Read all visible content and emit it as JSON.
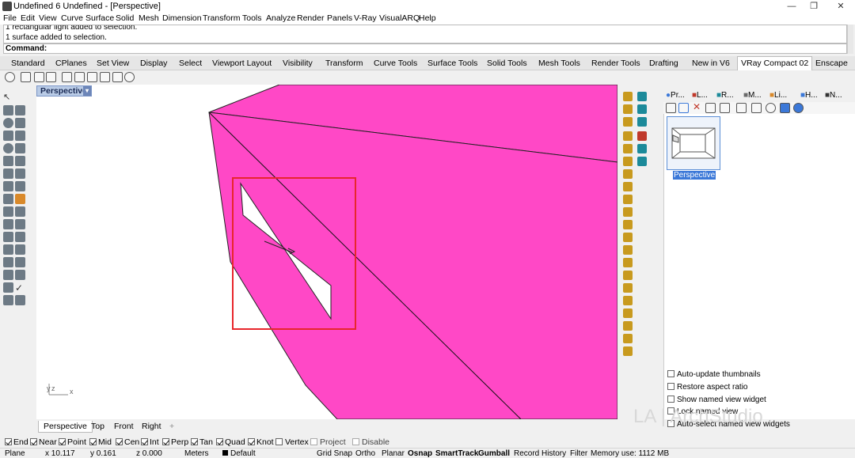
{
  "window": {
    "title": "Undefined 6 Undefined - [Perspective]",
    "minimize": "—",
    "maximize": "❐",
    "close": "✕"
  },
  "menu": [
    "File",
    "Edit",
    "View",
    "Curve",
    "Surface",
    "Solid",
    "Mesh",
    "Dimension",
    "Transform",
    "Tools",
    "Analyze",
    "Render",
    "Panels",
    "V-Ray",
    "VisualARQ",
    "Help"
  ],
  "command_history": [
    "1 rectangular light added to selection.",
    "1 surface added to selection."
  ],
  "command_prompt": "Command:",
  "toolbar_tabs": [
    "Standard",
    "CPlanes",
    "Set View",
    "Display",
    "Select",
    "Viewport Layout",
    "Visibility",
    "Transform",
    "Curve Tools",
    "Surface Tools",
    "Solid Tools",
    "Mesh Tools",
    "Render Tools",
    "Drafting",
    "New in V6",
    "VRay Compact 02",
    "Enscape"
  ],
  "active_toolbar_tab": "VRay Compact 02",
  "viewport": {
    "label": "Perspective",
    "dropdown": "▾",
    "axis_x": "x",
    "axis_y": "y",
    "axis_z": "z"
  },
  "viewport_tabs": [
    "Perspective",
    "Top",
    "Front",
    "Right"
  ],
  "viewport_add_tab": "+",
  "panel": {
    "tabs": [
      "Pr...",
      "L...",
      "R...",
      "M...",
      "Li...",
      "H...",
      "N..."
    ],
    "thumbnail_caption": "Perspective",
    "options": [
      {
        "label": "Auto-update thumbnails",
        "checked": false
      },
      {
        "label": "Restore aspect ratio",
        "checked": false
      },
      {
        "label": "Show named view widget",
        "checked": false
      },
      {
        "label": "Lock named view",
        "checked": false
      },
      {
        "label": "Auto-select named view widgets",
        "checked": false
      }
    ]
  },
  "osnap": [
    {
      "label": "End",
      "checked": true
    },
    {
      "label": "Near",
      "checked": true
    },
    {
      "label": "Point",
      "checked": true
    },
    {
      "label": "Mid",
      "checked": true
    },
    {
      "label": "Cen",
      "checked": true
    },
    {
      "label": "Int",
      "checked": true
    },
    {
      "label": "Perp",
      "checked": true
    },
    {
      "label": "Tan",
      "checked": true
    },
    {
      "label": "Quad",
      "checked": true
    },
    {
      "label": "Knot",
      "checked": true
    },
    {
      "label": "Vertex",
      "checked": false
    },
    {
      "label": "Project",
      "checked": false
    },
    {
      "label": "Disable",
      "checked": false
    }
  ],
  "status": {
    "cplane": "Plane",
    "x": "x 10.117",
    "y": "y 0.161",
    "z": "z 0.000",
    "units": "Meters",
    "layer": "Default",
    "grid_snap": "Grid Snap",
    "ortho": "Ortho",
    "planar": "Planar",
    "osnap": "Osnap",
    "smarttrack": "SmartTrack",
    "gumball": "Gumball",
    "record_history": "Record History",
    "filter": "Filter",
    "memory": "Memory use: 1112 MB"
  },
  "watermark": "LA | ArchStudio",
  "colors": {
    "surface": "#ff48c6",
    "highlight": "#e8262c",
    "accent": "#3b78d8"
  }
}
